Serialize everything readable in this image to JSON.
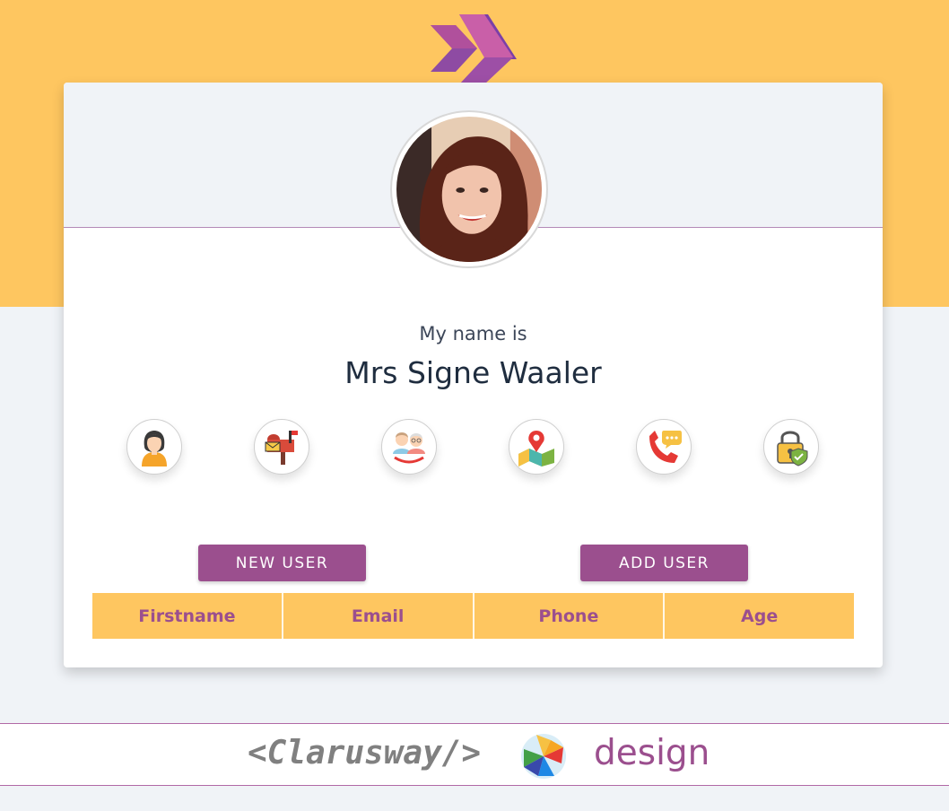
{
  "header": {
    "logo_icon": "double-chevron-logo-icon",
    "band_color": "#fec660"
  },
  "card": {
    "avatar_icon": "user-photo",
    "intro": "My name is",
    "name": "Mrs Signe Waaler",
    "info_icons": [
      {
        "name": "woman-icon",
        "topic": "name"
      },
      {
        "name": "mailbox-icon",
        "topic": "email"
      },
      {
        "name": "couple-elderly-icon",
        "topic": "age"
      },
      {
        "name": "map-pin-icon",
        "topic": "location"
      },
      {
        "name": "phone-chat-icon",
        "topic": "phone"
      },
      {
        "name": "padlock-shield-icon",
        "topic": "password"
      }
    ],
    "buttons": {
      "new_user": "NEW USER",
      "add_user": "ADD USER"
    },
    "table": {
      "columns": [
        "Firstname",
        "Email",
        "Phone",
        "Age"
      ]
    }
  },
  "footer": {
    "brand_code": "<Clarusway/>",
    "brand_logo_icon": "pinwheel-logo-icon",
    "brand_word": "design"
  },
  "colors": {
    "accent": "#9b4f8e",
    "yellow": "#fec660",
    "background": "#f0f3f7"
  }
}
